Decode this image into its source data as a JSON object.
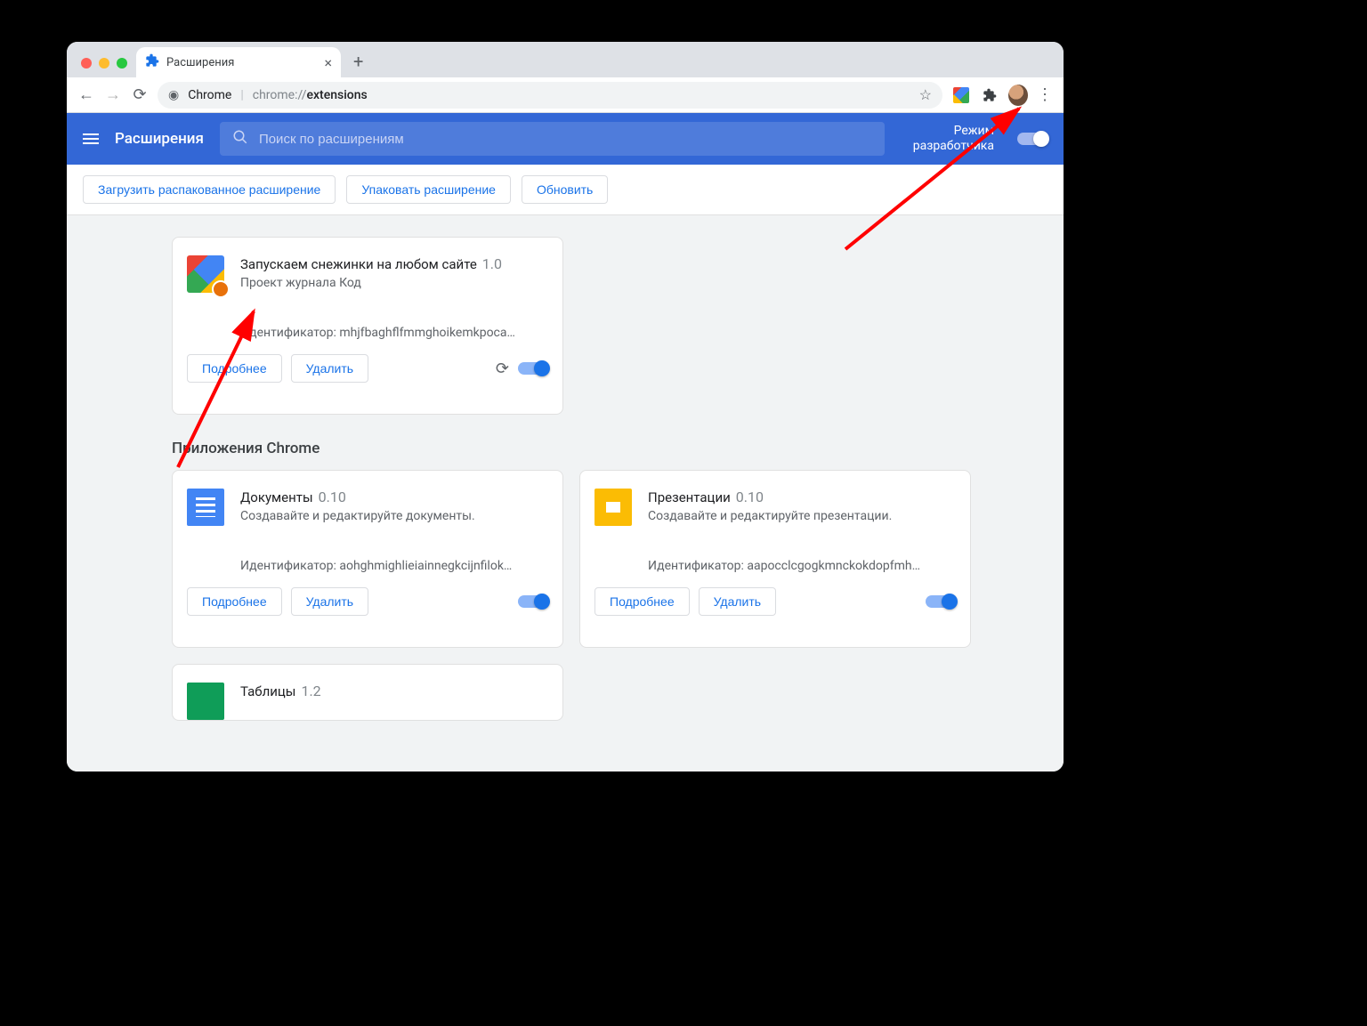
{
  "tab": {
    "title": "Расширения"
  },
  "omnibox": {
    "label": "Chrome",
    "path_prefix": "chrome://",
    "path_bold": "extensions"
  },
  "header": {
    "title": "Расширения",
    "search_placeholder": "Поиск по расширениям",
    "dev_mode_line1": "Режим",
    "dev_mode_line2": "разработчика"
  },
  "actions": {
    "load_unpacked": "Загрузить распакованное расширение",
    "pack": "Упаковать расширение",
    "update": "Обновить"
  },
  "buttons": {
    "details": "Подробнее",
    "remove": "Удалить"
  },
  "id_label": "Идентификатор: ",
  "sections": {
    "apps_title": "Приложения Chrome"
  },
  "extensions": [
    {
      "name": "Запускаем снежинки на любом сайте",
      "version": "1.0",
      "desc": "Проект журнала Код",
      "id": "mhjfbaghflfmmghoikemkpoca…",
      "icon": "snow",
      "has_reload": true
    }
  ],
  "apps": [
    {
      "name": "Документы",
      "version": "0.10",
      "desc": "Создавайте и редактируйте документы.",
      "id": "aohghmighlieiainnegkcijnfilok…",
      "icon": "docs"
    },
    {
      "name": "Презентации",
      "version": "0.10",
      "desc": "Создавайте и редактируйте презентации.",
      "id": "aapocclcgogkmnckokdopfmh…",
      "icon": "slides"
    },
    {
      "name": "Таблицы",
      "version": "1.2",
      "desc": "",
      "id": "",
      "icon": "sheets"
    }
  ]
}
